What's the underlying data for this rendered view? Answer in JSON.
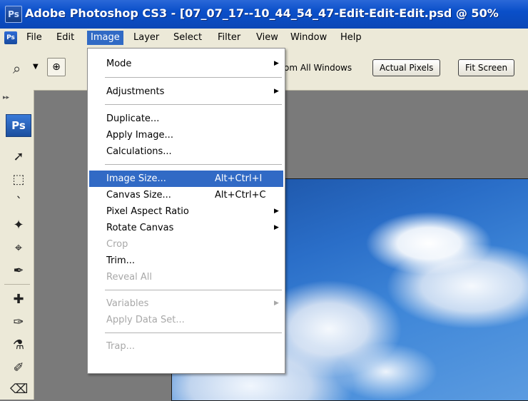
{
  "window": {
    "app_icon": "Ps",
    "title": "Adobe Photoshop CS3 - [07_07_17--10_44_54_47-Edit-Edit-Edit.psd @ 50%"
  },
  "menubar": {
    "icon": "Ps",
    "items": [
      "File",
      "Edit",
      "Image",
      "Layer",
      "Select",
      "Filter",
      "View",
      "Window",
      "Help"
    ],
    "active": "Image"
  },
  "options_bar": {
    "zoom_all_text": "om All Windows",
    "actual_pixels_label": "Actual Pixels",
    "fit_screen_label": "Fit Screen"
  },
  "toolbox": {
    "logo": "Ps"
  },
  "image_menu": {
    "items": [
      {
        "label": "Mode",
        "shortcut": "",
        "submenu": true,
        "enabled": true
      },
      {
        "label": "Adjustments",
        "shortcut": "",
        "submenu": true,
        "enabled": true
      },
      {
        "label": "Duplicate...",
        "shortcut": "",
        "submenu": false,
        "enabled": true
      },
      {
        "label": "Apply Image...",
        "shortcut": "",
        "submenu": false,
        "enabled": true
      },
      {
        "label": "Calculations...",
        "shortcut": "",
        "submenu": false,
        "enabled": true
      },
      {
        "label": "Image Size...",
        "shortcut": "Alt+Ctrl+I",
        "submenu": false,
        "enabled": true,
        "highlighted": true
      },
      {
        "label": "Canvas Size...",
        "shortcut": "Alt+Ctrl+C",
        "submenu": false,
        "enabled": true
      },
      {
        "label": "Pixel Aspect Ratio",
        "shortcut": "",
        "submenu": true,
        "enabled": true
      },
      {
        "label": "Rotate Canvas",
        "shortcut": "",
        "submenu": true,
        "enabled": true
      },
      {
        "label": "Crop",
        "shortcut": "",
        "submenu": false,
        "enabled": false
      },
      {
        "label": "Trim...",
        "shortcut": "",
        "submenu": false,
        "enabled": true
      },
      {
        "label": "Reveal All",
        "shortcut": "",
        "submenu": false,
        "enabled": false
      },
      {
        "label": "Variables",
        "shortcut": "",
        "submenu": true,
        "enabled": false
      },
      {
        "label": "Apply Data Set...",
        "shortcut": "",
        "submenu": false,
        "enabled": false
      },
      {
        "label": "Trap...",
        "shortcut": "",
        "submenu": false,
        "enabled": false
      }
    ]
  },
  "colors": {
    "title_bar": "#0a4fc9",
    "menu_highlight": "#316ac5",
    "chrome": "#ece9d8",
    "workspace": "#7a7a7a"
  }
}
